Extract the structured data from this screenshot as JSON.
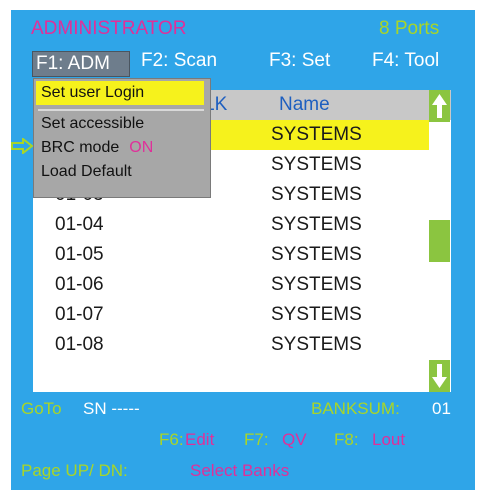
{
  "header": {
    "title": "ADMINISTRATOR",
    "ports": "8 Ports"
  },
  "menu": {
    "f1": "F1: ADM",
    "f2": "F2: Scan",
    "f3": "F3: Set",
    "f4": "F4: Tool"
  },
  "list": {
    "headers": {
      "lk": "LK",
      "name": "Name"
    },
    "rows": [
      {
        "num": "",
        "name": "SYSTEMS",
        "selected": true
      },
      {
        "num": "",
        "name": "SYSTEMS",
        "selected": false
      },
      {
        "num": "01-03",
        "name": "SYSTEMS",
        "selected": false
      },
      {
        "num": "01-04",
        "name": "SYSTEMS",
        "selected": false
      },
      {
        "num": "01-05",
        "name": "SYSTEMS",
        "selected": false
      },
      {
        "num": "01-06",
        "name": "SYSTEMS",
        "selected": false
      },
      {
        "num": "01-07",
        "name": "SYSTEMS",
        "selected": false
      },
      {
        "num": "01-08",
        "name": "SYSTEMS",
        "selected": false
      }
    ]
  },
  "dropdown": {
    "items": [
      "Set user Login",
      "Set accessible",
      "BRC mode",
      "Load Default"
    ],
    "brc_state": "ON"
  },
  "footer": {
    "goto": "GoTo",
    "sn": "SN -----",
    "banksum_label": "BANKSUM:",
    "banksum_value": "01",
    "f6_key": "F6:",
    "f6_val": "Edit",
    "f7_key": "F7:",
    "f7_val": "QV",
    "f8_key": "F8:",
    "f8_val": "Lout",
    "page_key": "Page UP/ DN:",
    "page_val": "Select Banks"
  },
  "icons": {
    "scroll_up": "arrow-up-icon",
    "scroll_down": "arrow-down-icon",
    "pointer": "arrow-right-outline-icon"
  },
  "colors": {
    "background": "#2fa5e8",
    "highlight": "#f6f21c",
    "accent_green": "#a8d528",
    "accent_magenta": "#e0309a",
    "scroll": "#8bc540"
  }
}
